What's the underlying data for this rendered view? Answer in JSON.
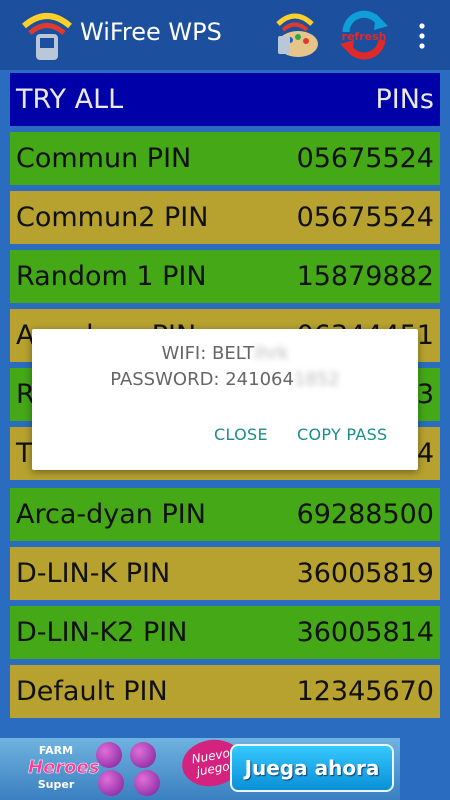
{
  "app": {
    "title": "WiFree WPS",
    "icons": {
      "app": "wifi-wps-icon",
      "palette": "palette-icon",
      "refresh": "refresh-icon",
      "refresh_label": "refresh",
      "overflow": "overflow-menu-icon"
    }
  },
  "list": {
    "header": {
      "left": "TRY ALL",
      "right": "PINs"
    },
    "rows": [
      {
        "name": "Commun PIN",
        "pin": "05675524"
      },
      {
        "name": "Commun2 PIN",
        "pin": "05675524"
      },
      {
        "name": "Random 1 PIN",
        "pin": "15879882"
      },
      {
        "name": "Arcadyan PIN",
        "pin": "06344451"
      },
      {
        "name": "R",
        "pin": "3"
      },
      {
        "name": "T",
        "pin": "4"
      },
      {
        "name": "Arca-dyan PIN",
        "pin": "69288500"
      },
      {
        "name": "D-LIN-K PIN",
        "pin": "36005819"
      },
      {
        "name": "D-LIN-K2 PIN",
        "pin": "36005814"
      },
      {
        "name": "Default PIN",
        "pin": "12345670"
      }
    ],
    "colors": {
      "header": "#0000a8",
      "green": "#44a817",
      "olive": "#b7a12f"
    }
  },
  "dialog": {
    "wifi_label": "WIFI: BELT",
    "wifi_hidden": "ihrk",
    "password_label": "PASSWORD: 241064",
    "password_hidden": "1852",
    "close": "CLOSE",
    "copy": "COPY PASS"
  },
  "ad": {
    "logo_top": "FARM",
    "logo_mid": "Heroes",
    "logo_bottom": "Super",
    "badge": "Nuevo juego",
    "button": "Juega ahora"
  }
}
